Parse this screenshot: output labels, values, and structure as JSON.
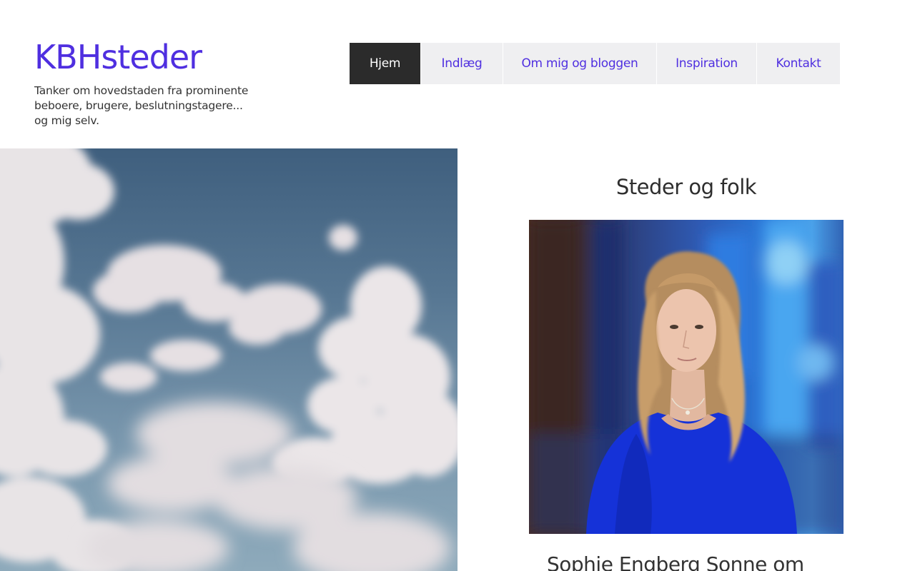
{
  "header": {
    "site_title": "KBHsteder",
    "tagline": "Tanker om hovedstaden fra prominente beboere, brugere, beslutningstagere... og mig selv."
  },
  "nav": {
    "items": [
      {
        "label": "Hjem",
        "active": true
      },
      {
        "label": "Indlæg",
        "active": false
      },
      {
        "label": "Om mig og bloggen",
        "active": false
      },
      {
        "label": "Inspiration",
        "active": false
      },
      {
        "label": "Kontakt",
        "active": false
      }
    ]
  },
  "featured": {
    "section_title": "Steder og folk",
    "post_title": "Sophie Engberg Sonne om"
  },
  "colors": {
    "accent": "#4f2fe0",
    "nav_bg": "#efeff1",
    "nav_active_bg": "#2b2b2b",
    "text": "#333333"
  }
}
